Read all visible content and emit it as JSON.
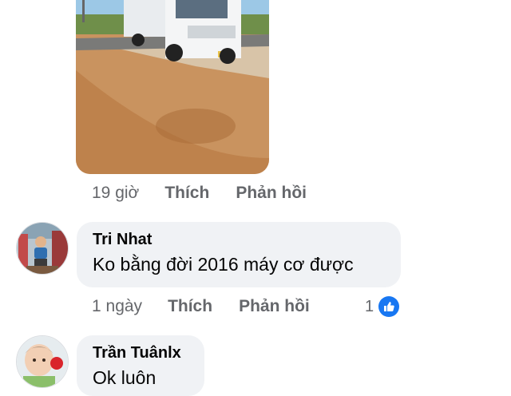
{
  "post_reply": {
    "time": "19 giờ",
    "like_label": "Thích",
    "reply_label": "Phản hồi",
    "image_icon": "truck-photo"
  },
  "comments": [
    {
      "author": "Tri Nhat",
      "text": "Ko bằng đời 2016 máy cơ được",
      "time": "1 ngày",
      "like_label": "Thích",
      "reply_label": "Phản hồi",
      "reaction_count": "1",
      "reaction_icon": "like-icon"
    },
    {
      "author": "Trần Tuânlx",
      "text": "Ok luôn"
    }
  ],
  "colors": {
    "bubble": "#f0f2f5",
    "meta_text": "#65676b",
    "like_blue": "#1877f2"
  }
}
